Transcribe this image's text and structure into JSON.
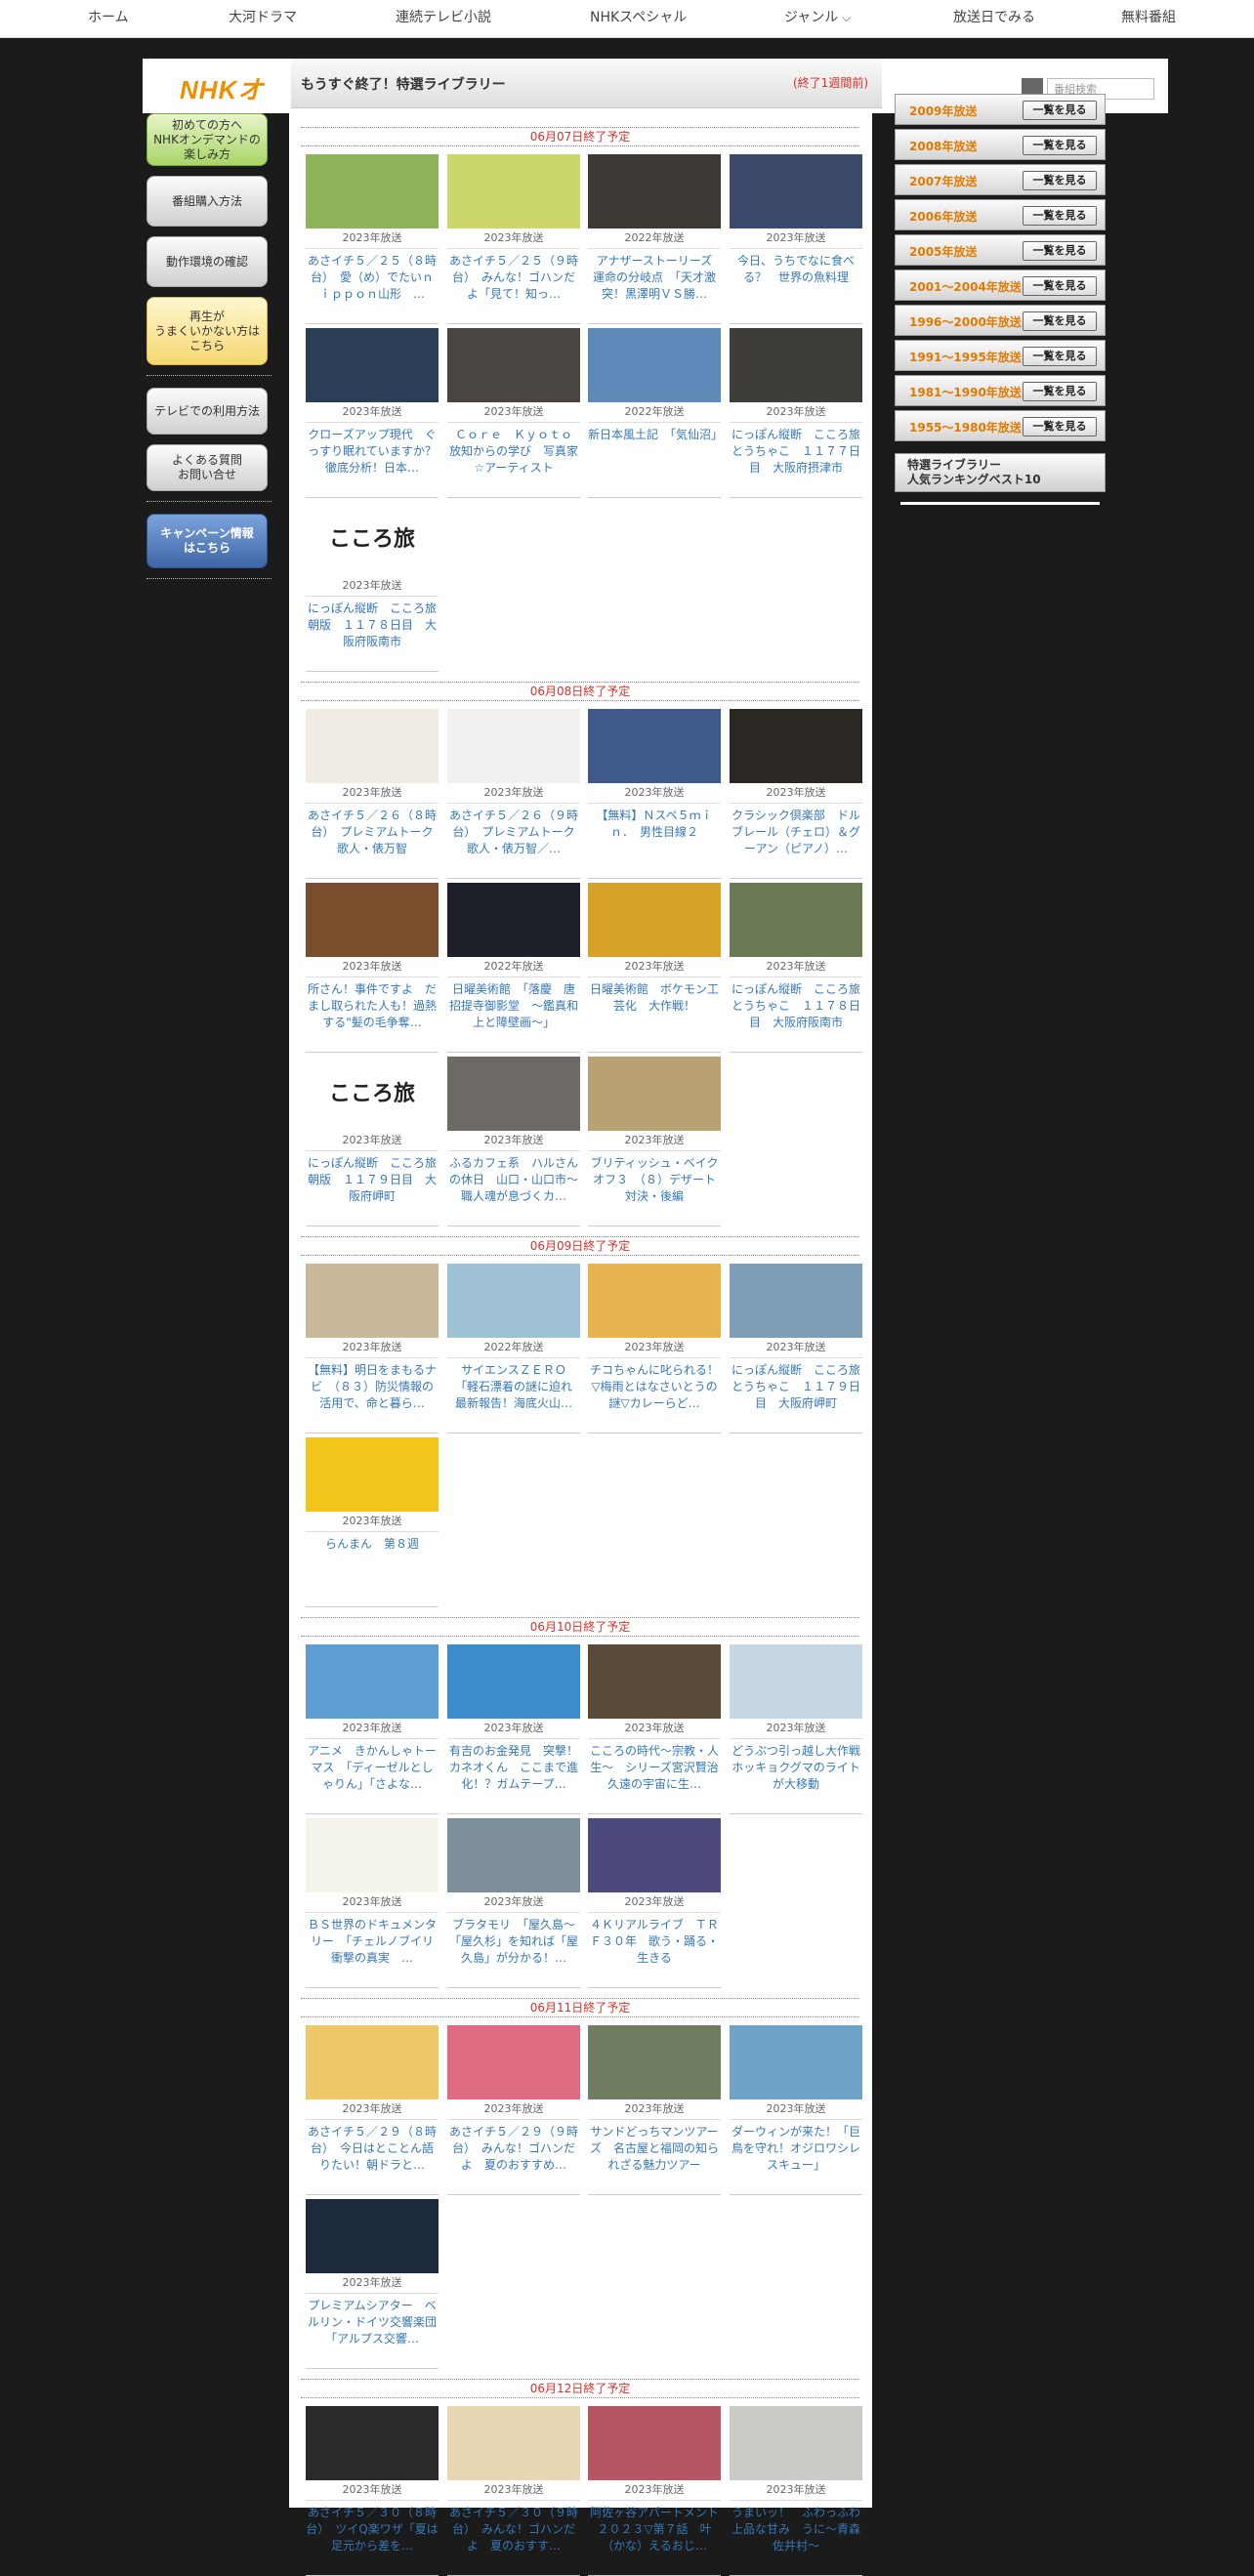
{
  "nav": [
    "ホーム",
    "大河ドラマ",
    "連続テレビ小説",
    "NHKスペシャル",
    "ジャンル",
    "放送日でみる",
    "無料番組"
  ],
  "nav_genre_chevron": "chevron-down-icon",
  "header": {
    "logo": "NHKオ",
    "title": "もうすぐ終了！特選ライブラリー",
    "subtitle": "(終了1週間前)",
    "search_placeholder": "番組検索"
  },
  "leftnav": [
    {
      "label": "初めての方へ\nNHKオンデマンドの\n楽しみ方",
      "style": "green"
    },
    {
      "label": "番組購入方法",
      "style": "gray"
    },
    {
      "label": "動作環境の確認",
      "style": "gray"
    },
    {
      "label": "再生が\nうまくいかない方は\nこちら",
      "style": "yellow"
    },
    {
      "label": "テレビでの利用方法",
      "style": "gray"
    },
    {
      "label": "よくある質問\nお問い合せ",
      "style": "gray"
    },
    {
      "label": "キャンペーン情報\nはこちら",
      "style": "blue"
    }
  ],
  "sections": [
    {
      "label": "06月07日終了予定",
      "items": [
        {
          "year": "2023年放送",
          "title": "あさイチ５／２５（８時台）　愛（め）でたいｎｉｐｐｏｎ山形　…",
          "c": "#8fb35a"
        },
        {
          "year": "2023年放送",
          "title": "あさイチ５／２５（９時台）　みんな！ゴハンだよ「見て！知っ…",
          "c": "#cbd66b"
        },
        {
          "year": "2022年放送",
          "title": "アナザーストーリーズ　運命の分岐点　「天才激突！黒澤明ＶＳ勝…",
          "c": "#3d3a36"
        },
        {
          "year": "2023年放送",
          "title": "今日、うちでなに食べる？　世界の魚料理",
          "c": "#3b4a6b"
        },
        {
          "year": "2023年放送",
          "title": "クローズアップ現代　ぐっすり眠れていますか？　徹底分析！日本…",
          "c": "#2a3f56"
        },
        {
          "year": "2023年放送",
          "title": "Ｃｏｒｅ　Ｋｙｏｔｏ　放知からの学び　写真家☆アーティスト",
          "c": "#4a4540"
        },
        {
          "year": "2022年放送",
          "title": "新日本風土記　「気仙沼」",
          "c": "#5f89b8"
        },
        {
          "year": "2023年放送",
          "title": "にっぽん縦断　こころ旅　とうちゃこ　１１７７日目　大阪府摂津市",
          "c": "#3e3d3a"
        },
        {
          "year": "2023年放送",
          "title": "にっぽん縦断　こころ旅　朝版　１１７８日目　大阪府阪南市",
          "c": "#ffffff",
          "logo": "こころ旅"
        }
      ]
    },
    {
      "label": "06月08日終了予定",
      "items": [
        {
          "year": "2023年放送",
          "title": "あさイチ５／２６（８時台）　プレミアムトーク　歌人・俵万智",
          "c": "#f0ebe3"
        },
        {
          "year": "2023年放送",
          "title": "あさイチ５／２６（９時台）　プレミアムトーク　歌人・俵万智／…",
          "c": "#f2f1ef"
        },
        {
          "year": "2023年放送",
          "title": "【無料】Ｎスペ５ｍｉｎ．　男性目線２",
          "c": "#3f5a8a"
        },
        {
          "year": "2023年放送",
          "title": "クラシック倶楽部　ドルブレール（チェロ）＆グーアン（ピアノ）…",
          "c": "#2b2824"
        },
        {
          "year": "2023年放送",
          "title": "所さん！事件ですよ　だまし取られた人も！過熱する\"髪の毛争奪…",
          "c": "#7a4d2c"
        },
        {
          "year": "2022年放送",
          "title": "日曜美術館　「落慶　唐招提寺御影堂　～鑑真和上と障壁画～」",
          "c": "#1e2029"
        },
        {
          "year": "2023年放送",
          "title": "日曜美術館　ボケモン工芸化　大作戦！",
          "c": "#d7a12a"
        },
        {
          "year": "2023年放送",
          "title": "にっぽん縦断　こころ旅　とうちゃこ　１１７８日目　大阪府阪南市",
          "c": "#6a7a54"
        },
        {
          "year": "2023年放送",
          "title": "にっぽん縦断　こころ旅　朝版　１１７９日目　大阪府岬町",
          "c": "#ffffff",
          "logo": "こころ旅"
        },
        {
          "year": "2023年放送",
          "title": "ふるカフェ系　ハルさんの休日　山口・山口市～職人魂が息づくカ…",
          "c": "#6e6a66"
        },
        {
          "year": "2023年放送",
          "title": "ブリティッシュ・ベイクオフ３　（８）デザート対決・後編",
          "c": "#b8a274"
        }
      ]
    },
    {
      "label": "06月09日終了予定",
      "items": [
        {
          "year": "2023年放送",
          "title": "【無料】明日をまもるナビ　（８３）防災情報の活用で、命と暮ら…",
          "c": "#c9b99a"
        },
        {
          "year": "2022年放送",
          "title": "サイエンスＺＥＲＯ　「軽石漂着の謎に迫れ　最新報告！海底火山…",
          "c": "#a0c2d6"
        },
        {
          "year": "2023年放送",
          "title": "チコちゃんに叱られる！　▽梅雨とはなさいとうの謎▽カレーらど…",
          "c": "#e7b450"
        },
        {
          "year": "2023年放送",
          "title": "にっぽん縦断　こころ旅　とうちゃこ　１１７９日目　大阪府岬町",
          "c": "#7f9fb9"
        },
        {
          "year": "2023年放送",
          "title": "らんまん　第８週",
          "c": "#f2c51b"
        }
      ]
    },
    {
      "label": "06月10日終了予定",
      "items": [
        {
          "year": "2023年放送",
          "title": "アニメ　きかんしゃトーマス　「ディーゼルとしゃりん」「さよな…",
          "c": "#5e9dd4"
        },
        {
          "year": "2023年放送",
          "title": "有吉のお金発見　突撃！カネオくん　ここまで進化！？ガムテープ…",
          "c": "#3d8ccc"
        },
        {
          "year": "2023年放送",
          "title": "こころの時代～宗教・人生～　シリーズ宮沢賢治　久遠の宇宙に生…",
          "c": "#5b4a3a"
        },
        {
          "year": "2023年放送",
          "title": "どうぶつ引っ越し大作戦　ホッキョクグマのライトが大移動",
          "c": "#c5d6e4"
        },
        {
          "year": "2023年放送",
          "title": "ＢＳ世界のドキュメンタリー　「チェルノブイリ　衝撃の真実　…",
          "c": "#f4f4ea"
        },
        {
          "year": "2023年放送",
          "title": "ブラタモリ　「屋久島～「屋久杉」を知れば「屋久島」が分かる！…",
          "c": "#7d8f9b"
        },
        {
          "year": "2023年放送",
          "title": "４Ｋリアルライブ　ＴＲＦ３０年　歌う・踊る・生きる",
          "c": "#4c4a7a"
        }
      ]
    },
    {
      "label": "06月11日終了予定",
      "items": [
        {
          "year": "2023年放送",
          "title": "あさイチ５／２９（８時台）　今日はとことん語りたい！朝ドラと…",
          "c": "#eec86a"
        },
        {
          "year": "2023年放送",
          "title": "あさイチ５／２９（９時台）　みんな！ゴハンだよ　夏のおすすめ…",
          "c": "#e06c84"
        },
        {
          "year": "2023年放送",
          "title": "サンドどっちマンツアーズ　名古屋と福岡の知られざる魅力ツアー",
          "c": "#6f7d62"
        },
        {
          "year": "2023年放送",
          "title": "ダーウィンが来た！「巨鳥を守れ！オジロワシレスキュー」",
          "c": "#6fa3c9"
        },
        {
          "year": "2023年放送",
          "title": "プレミアムシアター　ベルリン・ドイツ交響楽団　「アルプス交響…",
          "c": "#1d2a3e"
        }
      ]
    },
    {
      "label": "06月12日終了予定",
      "items": [
        {
          "year": "2023年放送",
          "title": "あさイチ５／３０（８時台）　ツイQ楽ワザ「夏は足元から差を…",
          "c": "#2a2a2a"
        },
        {
          "year": "2023年放送",
          "title": "あさイチ５／３０（９時台）　みんな！ゴハンだよ　夏のおすす…",
          "c": "#e9d7b4"
        },
        {
          "year": "2023年放送",
          "title": "阿佐ヶ谷アパートメント　２０２３▽第７話　叶（かな）えるおじ…",
          "c": "#b65563"
        },
        {
          "year": "2023年放送",
          "title": "うまいッ！　ふわっふわ　上品な甘み　うに～青森　佐井村～",
          "c": "#c9cbc6"
        }
      ]
    }
  ],
  "sidebar": {
    "years": [
      "2009年放送",
      "2008年放送",
      "2007年放送",
      "2006年放送",
      "2005年放送",
      "2001～2004年放送",
      "1996～2000年放送",
      "1991～1995年放送",
      "1981～1990年放送",
      "1955～1980年放送"
    ],
    "list_button": "一覧を見る",
    "ranking": "特選ライブラリー\n人気ランキングベスト10"
  }
}
